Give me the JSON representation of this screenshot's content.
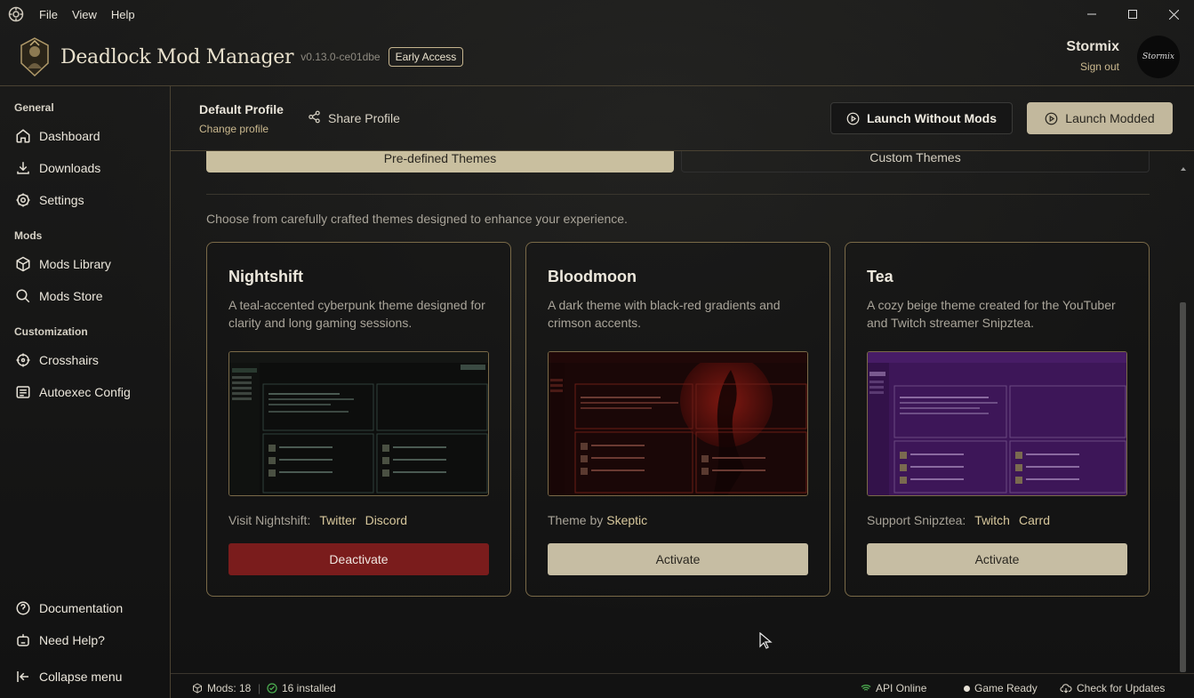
{
  "menubar": {
    "items": [
      "File",
      "View",
      "Help"
    ]
  },
  "header": {
    "title": "Deadlock Mod Manager",
    "version": "v0.13.0-ce01dbe",
    "badge": "Early Access",
    "user": {
      "name": "Stormix",
      "signout": "Sign out",
      "avatar_text": "Stormix"
    }
  },
  "sidebar": {
    "sections": [
      {
        "label": "General",
        "items": [
          {
            "label": "Dashboard",
            "icon": "home-icon"
          },
          {
            "label": "Downloads",
            "icon": "download-icon"
          },
          {
            "label": "Settings",
            "icon": "gear-icon"
          }
        ]
      },
      {
        "label": "Mods",
        "items": [
          {
            "label": "Mods Library",
            "icon": "package-icon"
          },
          {
            "label": "Mods Store",
            "icon": "search-icon"
          }
        ]
      },
      {
        "label": "Customization",
        "items": [
          {
            "label": "Crosshairs",
            "icon": "crosshair-icon"
          },
          {
            "label": "Autoexec Config",
            "icon": "list-icon"
          }
        ]
      }
    ],
    "bottom": [
      {
        "label": "Documentation",
        "icon": "help-circle-icon"
      },
      {
        "label": "Need Help?",
        "icon": "bot-icon"
      },
      {
        "label": "Collapse menu",
        "icon": "collapse-icon"
      }
    ]
  },
  "profile": {
    "name": "Default Profile",
    "change": "Change profile",
    "share": "Share Profile",
    "launch_plain": "Launch Without Mods",
    "launch_modded": "Launch Modded"
  },
  "themes": {
    "tabs": [
      "Pre-defined Themes",
      "Custom Themes"
    ],
    "intro": "Choose from carefully crafted themes designed to enhance your experience.",
    "cards": [
      {
        "title": "Nightshift",
        "description": "A teal-accented cyberpunk theme designed for clarity and long gaming sessions.",
        "link_prefix": "Visit Nightshift:",
        "links": [
          "Twitter",
          "Discord"
        ],
        "button": "Deactivate"
      },
      {
        "title": "Bloodmoon",
        "description": "A dark theme with black-red gradients and crimson accents.",
        "link_prefix": "Theme by",
        "links": [
          "Skeptic"
        ],
        "button": "Activate"
      },
      {
        "title": "Tea",
        "description": "A cozy beige theme created for the YouTuber and Twitch streamer Snipztea.",
        "link_prefix": "Support Snipztea:",
        "links": [
          "Twitch",
          "Carrd"
        ],
        "button": "Activate"
      }
    ]
  },
  "status": {
    "mods": "Mods: 18",
    "installed": "16 installed",
    "api": "API Online",
    "game": "Game Ready",
    "updates": "Check for Updates"
  },
  "colors": {
    "accent": "#c6bda3",
    "border": "#7a6a48",
    "danger": "#7a1c1c",
    "online": "#4caf50"
  }
}
